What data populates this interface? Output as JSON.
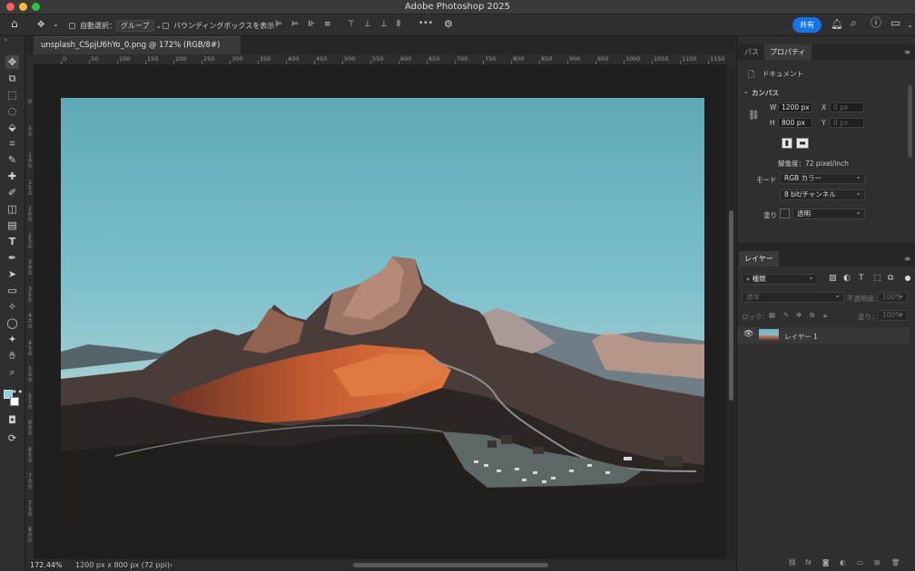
{
  "window": {
    "title": "Adobe Photoshop 2025"
  },
  "options_bar": {
    "auto_select_label": "自動選択：",
    "auto_select_value": "グループ",
    "bounding_box_label": "バウンディングボックスを表示",
    "more_label": "•••",
    "share_label": "共有"
  },
  "document": {
    "tab_title": "unsplash_CSpjU6hYo_0.png @ 172% (RGB/8#)"
  },
  "ruler": {
    "h_ticks": [
      "0",
      "50",
      "100",
      "150",
      "200",
      "250",
      "300",
      "350",
      "400",
      "450",
      "500",
      "550",
      "600",
      "650",
      "700",
      "750",
      "800",
      "850",
      "900",
      "950",
      "1000",
      "1050",
      "1100",
      "1150",
      "1200"
    ],
    "v_ticks": [
      "0",
      "50",
      "100",
      "150",
      "200",
      "250",
      "300",
      "350",
      "400",
      "450",
      "500",
      "550",
      "600",
      "650",
      "700",
      "750",
      "800"
    ]
  },
  "status": {
    "zoom": "172.44%",
    "doc_info": "1200 px x 800 px (72 ppi)",
    "arrow": "›"
  },
  "properties_panel": {
    "tabs": [
      "パス",
      "プロパティ"
    ],
    "active_tab": "プロパティ",
    "doc_label": "ドキュメント",
    "canvas_section": "カンバス",
    "w_label": "W",
    "w_value": "1200 px",
    "h_label": "H",
    "h_value": "800 px",
    "x_label": "X",
    "x_placeholder": "0 px",
    "y_label": "Y",
    "y_placeholder": "0 px",
    "resolution": "解像度：72 pixel/inch",
    "mode_label": "モード",
    "mode_value": "RGB カラー",
    "depth_value": "8 bit/チャンネル",
    "fill_label": "塗り",
    "fill_value": "透明"
  },
  "layers_panel": {
    "tab": "レイヤー",
    "filter_value": "種類",
    "blend_mode": "通常",
    "opacity_label": "不透明度：",
    "opacity_value": "100%",
    "lock_label": "ロック：",
    "fill_label": "塗り：",
    "fill_value": "100%",
    "layers": [
      {
        "name": "レイヤー 1",
        "visible": true
      }
    ]
  },
  "colors": {
    "accent": "#1473e6",
    "foreground_swatch": "#8fd0d8",
    "background_swatch": "#ffffff"
  }
}
